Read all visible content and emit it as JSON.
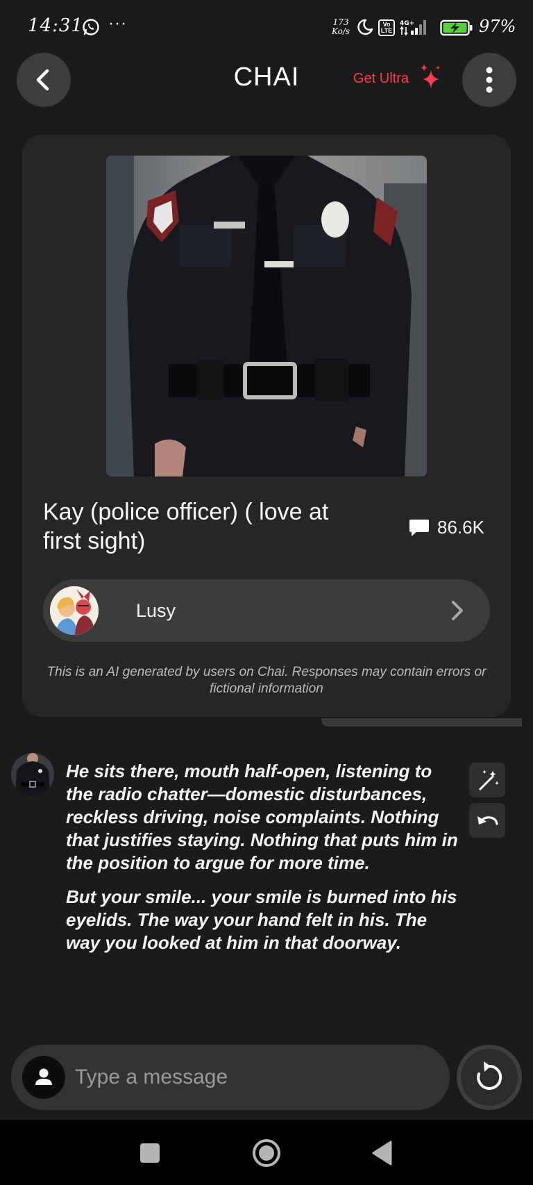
{
  "status_bar": {
    "time": "14:31",
    "more": "···",
    "net_speed_value": "173",
    "net_speed_unit": "Ko/s",
    "volte_label": "Vo LTE",
    "network_type": "4G+",
    "battery_percent": "97%"
  },
  "header": {
    "title": "CHAI",
    "get_ultra_label": "Get Ultra",
    "accent_color": "#ff3b4f"
  },
  "bot": {
    "name": "Kay (police officer) ( love at first sight)",
    "message_count": "86.6K",
    "creator_name": "Lusy",
    "disclaimer": "This is an AI generated by users on Chai. Responses may contain errors or fictional information"
  },
  "messages": [
    {
      "sender": "bot",
      "paragraphs": [
        "He sits there, mouth half-open, listening to the radio chatter—domestic disturbances, reckless driving, noise complaints. Nothing that justifies staying. Nothing that puts him in the position to argue for more time.",
        "But your smile... your smile is burned into his eyelids. The way your hand felt in his. The way you looked at him in that doorway."
      ]
    }
  ],
  "composer": {
    "placeholder": "Type a message"
  },
  "icons": {
    "back": "arrow-left-icon",
    "menu": "vertical-dots-icon",
    "sparkle": "sparkle-icon",
    "chat": "chat-bubble-icon",
    "chevron": "chevron-right-icon",
    "magic": "magic-wand-icon",
    "undo": "undo-icon",
    "user": "person-icon",
    "regenerate": "refresh-icon"
  }
}
